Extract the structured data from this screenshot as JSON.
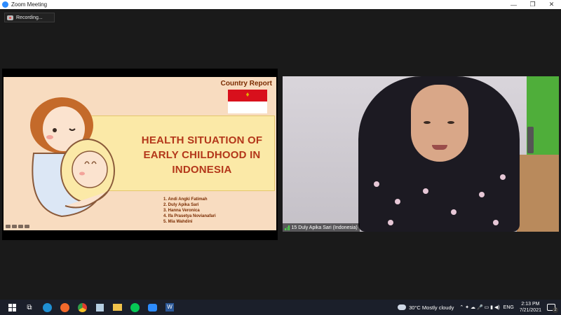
{
  "window": {
    "title": "Zoom Meeting",
    "controls": [
      "—",
      "❐",
      "✕"
    ]
  },
  "recording": {
    "label": "Recording..."
  },
  "slide": {
    "country_report": "Country Report",
    "title": "HEALTH SITUATION OF EARLY CHILDHOOD IN INDONESIA",
    "authors": [
      "1.  Andi Angki Fatimah",
      "2.  Duly Apika Sari",
      "3.  Hanna Veronica",
      "4.  Ifa Prasetya Novianafari",
      "5.  Mia Wahdini"
    ]
  },
  "video": {
    "participant_name": "15 Duly Apika Sari (Indonesia)"
  },
  "taskbar": {
    "apps": [
      "windows-start",
      "task-view",
      "edge",
      "firefox",
      "chrome",
      "notes",
      "file-explorer",
      "line",
      "zoom",
      "word"
    ],
    "weather": "30°C  Mostly cloudy",
    "language": "ENG",
    "time": "2:13 PM",
    "date": "7/21/2021",
    "notifications": "2"
  },
  "colors": {
    "slide_bg": "#f8dcc0",
    "banner": "#fbe9a7",
    "title_red": "#b3371a",
    "zoom_blue": "#2d8cff"
  }
}
